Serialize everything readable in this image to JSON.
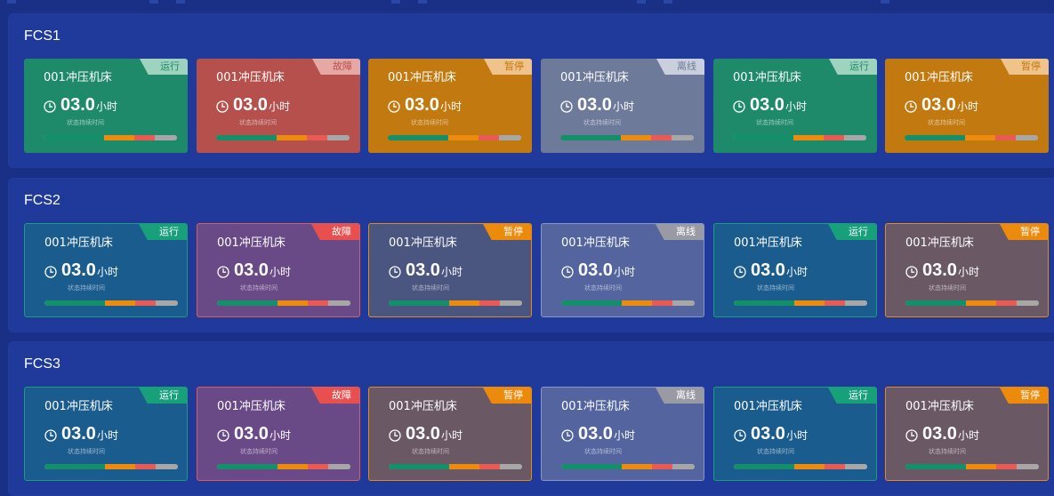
{
  "card_text": {
    "name": "001冲压机床",
    "value": "03.0",
    "unit": "小时",
    "sub": "状态持续时间"
  },
  "status_labels": {
    "run": "运行",
    "fault": "故障",
    "pause": "暂停",
    "offline": "离线"
  },
  "bar_segments": [
    {
      "status": "run",
      "fraction": 0.45,
      "color": "#13906a"
    },
    {
      "status": "pause",
      "fraction": 0.23,
      "color": "#ec8b0e"
    },
    {
      "status": "fault",
      "fraction": 0.15,
      "color": "#ea5a55"
    },
    {
      "status": "offline",
      "fraction": 0.17,
      "color": "#a7a7a7"
    }
  ],
  "groups": [
    {
      "title": "FCS1",
      "variant": "solid",
      "cards": [
        "run",
        "fault",
        "pause",
        "offline",
        "run",
        "pause"
      ]
    },
    {
      "title": "FCS2",
      "variant": "tinted",
      "cards": [
        "run",
        "fault",
        "pause",
        "offline",
        "run",
        "pause"
      ]
    },
    {
      "title": "FCS3",
      "variant": "tinted",
      "cards": [
        "run",
        "fault",
        "pause",
        "offline",
        "run",
        "pause"
      ]
    }
  ],
  "colors": {
    "background": "#1a2f86",
    "panel": "#1f3a9a",
    "solid_cards": {
      "run": "#1f8a6a",
      "fault": "#b5504c",
      "pause": "#c27a10",
      "offline": "#6e7a9a"
    },
    "solid_tags": {
      "run": "#9dd3bf",
      "fault": "#e7a8a4",
      "pause": "#efc389",
      "offline": "#c9cfdc"
    },
    "tinted_cards": {
      "run": "#1a5c8e",
      "fault": "#6a4a86",
      "pause": "#4a5580",
      "offline": "#53649e"
    },
    "tinted_borders": {
      "run": "#17a07a",
      "fault": "#e45a58",
      "pause": "#e98b12",
      "offline": "#8a97c5"
    },
    "tinted_tags": {
      "run": "#17a07a",
      "fault": "#e84f4f",
      "pause": "#ec8a0c",
      "offline": "#9a9aa5"
    },
    "tinted_pause_fcs2_last": "#6a5965",
    "tinted_pause_fcs3": "#6a5865"
  }
}
